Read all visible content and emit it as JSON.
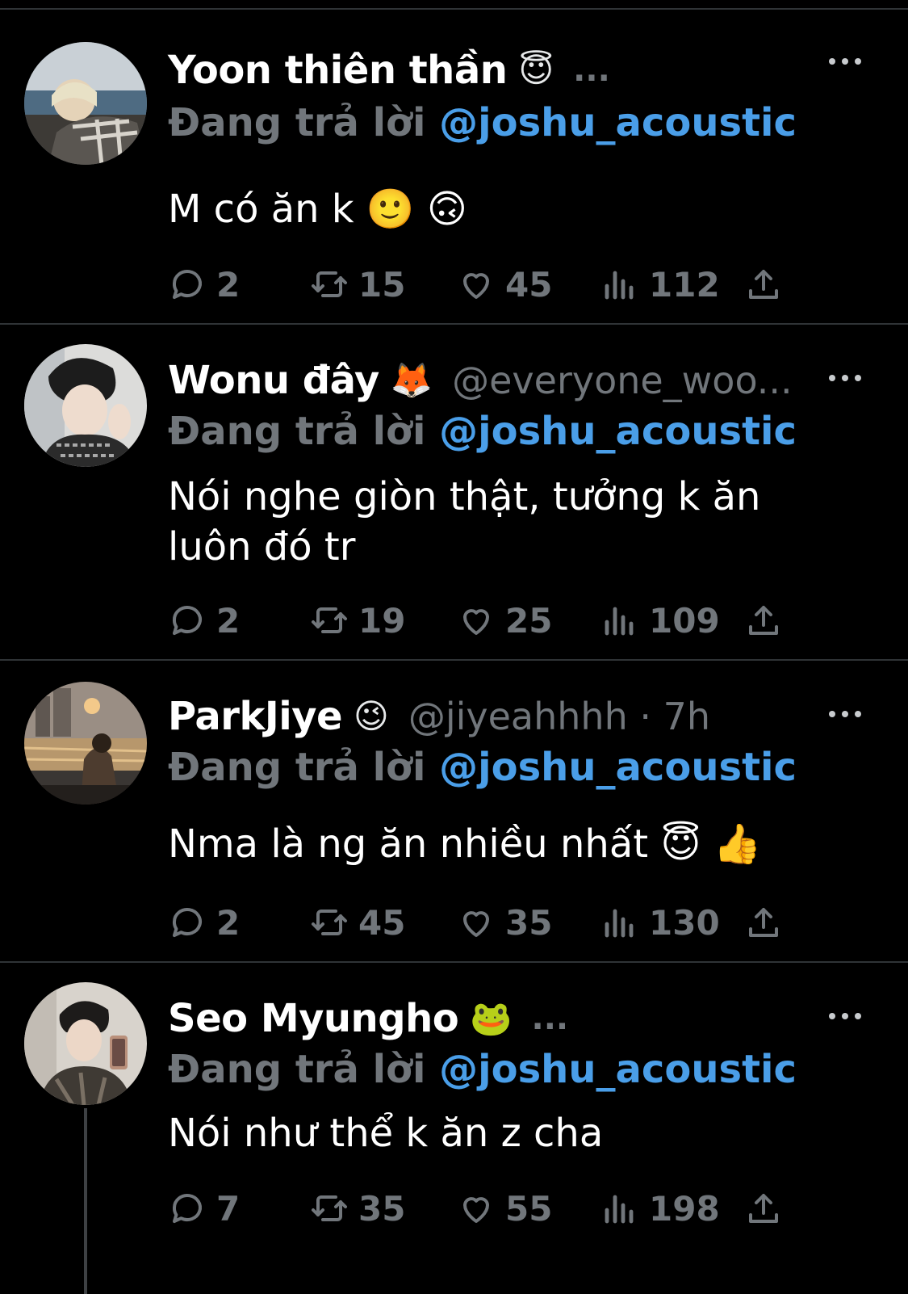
{
  "tweets": [
    {
      "name": "Yoon thiên thần",
      "emoji": "😇",
      "handle": "",
      "ellipsis": "...",
      "reply_label": "Đang trả lời",
      "reply_mention": "@joshu_acoustic",
      "content_lines": [
        "M có ăn k 🙂 🙃"
      ],
      "stats": {
        "replies": "2",
        "retweets": "15",
        "likes": "45",
        "views": "112"
      }
    },
    {
      "name": "Wonu đây",
      "emoji": "🦊",
      "handle": "@everyone_woo...",
      "ellipsis": "",
      "reply_label": "Đang trả lời",
      "reply_mention": "@joshu_acoustic",
      "content_lines": [
        "Nói nghe giòn thật, tưởng k ăn",
        "luôn đó tr"
      ],
      "stats": {
        "replies": "2",
        "retweets": "19",
        "likes": "25",
        "views": "109"
      }
    },
    {
      "name": "ParkJiye",
      "emoji": "😉",
      "handle": "@jiyeahhhh · 7h",
      "ellipsis": "",
      "reply_label": "Đang trả lời",
      "reply_mention": "@joshu_acoustic",
      "content_lines": [
        "Nma là ng ăn nhiều nhất 😇 👍"
      ],
      "stats": {
        "replies": "2",
        "retweets": "45",
        "likes": "35",
        "views": "130"
      }
    },
    {
      "name": "Seo Myungho",
      "emoji": "🐸",
      "handle": "",
      "ellipsis": "...",
      "reply_label": "Đang trả lời",
      "reply_mention": "@joshu_acoustic",
      "content_lines": [
        "Nói như thể k ăn z cha"
      ],
      "stats": {
        "replies": "7",
        "retweets": "35",
        "likes": "55",
        "views": "198"
      }
    }
  ],
  "colors": {
    "background": "#000000",
    "text": "#ffffff",
    "muted": "#71767b",
    "mention": "#4a9ee8",
    "divider": "#2f3336"
  },
  "icons": [
    "reply-icon",
    "retweet-icon",
    "like-icon",
    "views-icon",
    "share-icon",
    "more-icon"
  ]
}
